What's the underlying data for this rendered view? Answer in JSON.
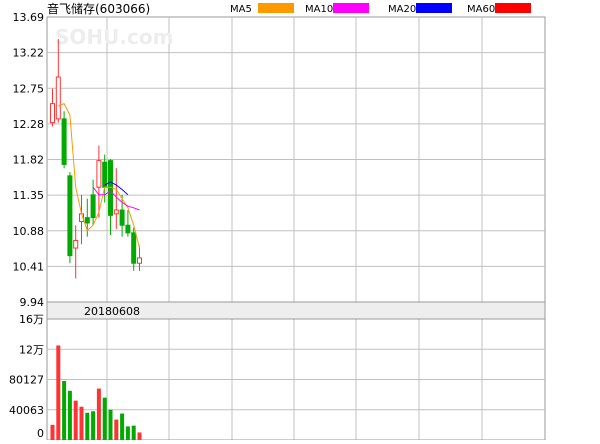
{
  "chart_data": {
    "type": "candlestick",
    "title": "音飞储存(603066)",
    "watermark": "SOHU.com",
    "legend": [
      {
        "label": "MA5",
        "color": "#ff9900"
      },
      {
        "label": "MA10",
        "color": "#ff00ff"
      },
      {
        "label": "MA20",
        "color": "#0000ff"
      },
      {
        "label": "MA60",
        "color": "#ff0000"
      }
    ],
    "price_axis": {
      "ticks": [
        "13.69",
        "13.22",
        "12.75",
        "12.28",
        "11.82",
        "11.35",
        "10.88",
        "10.41",
        "9.94"
      ],
      "ylim": [
        9.94,
        13.69
      ]
    },
    "date_label": "20180608",
    "volume_axis": {
      "ticks": [
        "16万",
        "12万",
        "80127",
        "40063",
        "0"
      ],
      "ylim": [
        0,
        160000
      ]
    },
    "colors": {
      "up": "#ff3333",
      "down": "#00aa00",
      "grid": "#c0c0c0",
      "border": "#999999",
      "band": "#eeeeee"
    },
    "candles": [
      {
        "o": 12.3,
        "h": 12.75,
        "l": 12.25,
        "c": 12.55
      },
      {
        "o": 12.35,
        "h": 13.4,
        "l": 12.3,
        "c": 12.9
      },
      {
        "o": 12.35,
        "h": 12.45,
        "l": 11.7,
        "c": 11.75
      },
      {
        "o": 11.6,
        "h": 11.65,
        "l": 10.45,
        "c": 10.55
      },
      {
        "o": 10.65,
        "h": 10.95,
        "l": 10.25,
        "c": 10.75
      },
      {
        "o": 11.0,
        "h": 11.35,
        "l": 10.7,
        "c": 11.1
      },
      {
        "o": 11.05,
        "h": 11.3,
        "l": 10.8,
        "c": 10.98
      },
      {
        "o": 11.35,
        "h": 11.55,
        "l": 10.95,
        "c": 11.05
      },
      {
        "o": 11.45,
        "h": 12.0,
        "l": 11.05,
        "c": 11.8
      },
      {
        "o": 11.78,
        "h": 11.88,
        "l": 11.25,
        "c": 11.45
      },
      {
        "o": 11.8,
        "h": 11.82,
        "l": 10.82,
        "c": 11.08
      },
      {
        "o": 11.1,
        "h": 11.7,
        "l": 10.9,
        "c": 11.15
      },
      {
        "o": 11.15,
        "h": 11.35,
        "l": 10.8,
        "c": 10.95
      },
      {
        "o": 10.95,
        "h": 11.15,
        "l": 10.8,
        "c": 10.85
      },
      {
        "o": 10.85,
        "h": 10.92,
        "l": 10.35,
        "c": 10.45
      },
      {
        "o": 10.45,
        "h": 10.68,
        "l": 10.35,
        "c": 10.52
      }
    ],
    "volume": [
      20000,
      125000,
      78000,
      65000,
      52000,
      44000,
      36000,
      38000,
      68000,
      56000,
      40000,
      27000,
      35000,
      18000,
      19000,
      10000
    ],
    "ma5": [
      null,
      12.52,
      12.55,
      12.4,
      11.45,
      11.1,
      10.88,
      10.95,
      11.12,
      11.45,
      11.45,
      11.42,
      11.3,
      11.18,
      10.95,
      10.65
    ],
    "ma10": [
      null,
      null,
      null,
      null,
      null,
      null,
      null,
      11.45,
      11.35,
      11.35,
      11.4,
      11.32,
      11.25,
      11.2,
      11.18,
      11.15
    ],
    "ma20": [
      null,
      null,
      null,
      null,
      null,
      null,
      null,
      null,
      null,
      11.48,
      11.52,
      11.48,
      11.42,
      11.35,
      null,
      null
    ]
  }
}
